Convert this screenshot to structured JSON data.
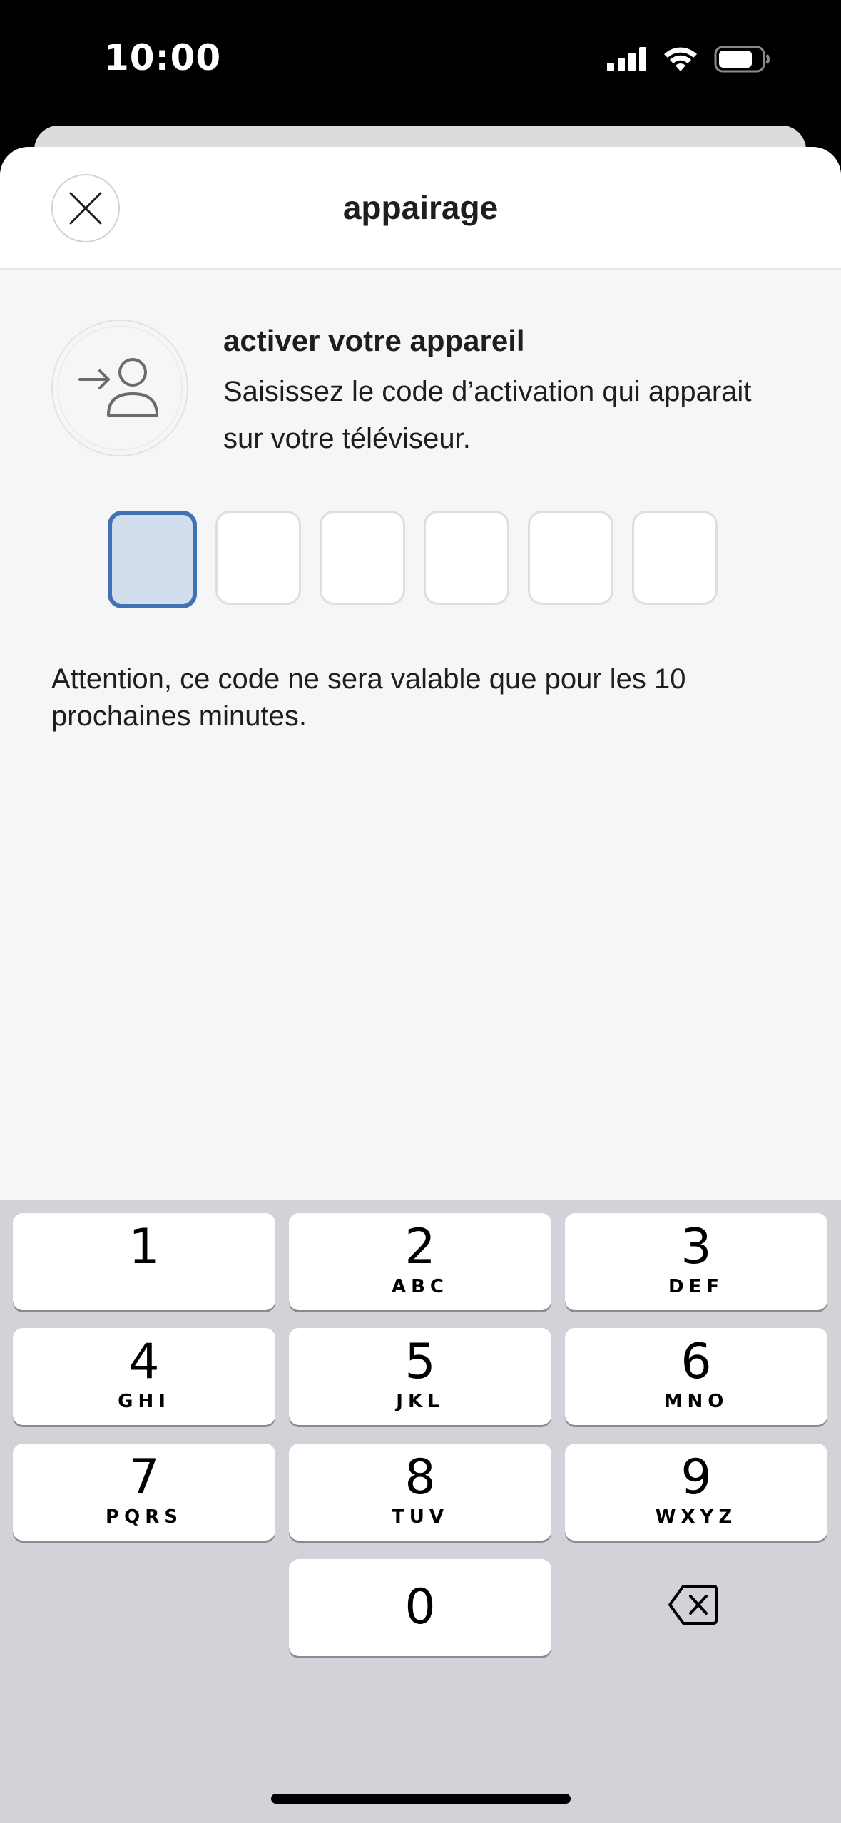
{
  "status_bar": {
    "time": "10:00",
    "icons": [
      "cellular-signal-icon",
      "wifi-icon",
      "battery-icon"
    ]
  },
  "modal": {
    "title": "appairage",
    "close_icon": "close-icon"
  },
  "activation": {
    "icon": "person-sign-in-icon",
    "title": "activer votre appareil",
    "description": "Saisissez le code d’activation qui apparait sur votre téléviseur.",
    "code_values": [
      "",
      "",
      "",
      "",
      "",
      ""
    ],
    "warning": "Attention, ce code ne sera valable que pour les 10 prochaines minutes."
  },
  "keyboard": {
    "keys": [
      {
        "digit": "1",
        "letters": ""
      },
      {
        "digit": "2",
        "letters": "ABC"
      },
      {
        "digit": "3",
        "letters": "DEF"
      },
      {
        "digit": "4",
        "letters": "GHI"
      },
      {
        "digit": "5",
        "letters": "JKL"
      },
      {
        "digit": "6",
        "letters": "MNO"
      },
      {
        "digit": "7",
        "letters": "PQRS"
      },
      {
        "digit": "8",
        "letters": "TUV"
      },
      {
        "digit": "9",
        "letters": "WXYZ"
      },
      {
        "digit": "0",
        "letters": ""
      }
    ],
    "backspace_icon": "backspace-icon"
  },
  "colors": {
    "accent": "#3f73b6",
    "active_fill": "#d3deed",
    "keyboard_bg": "#d1d3d9"
  }
}
